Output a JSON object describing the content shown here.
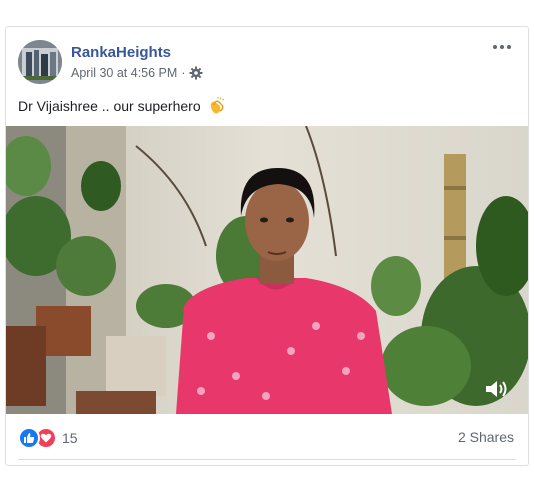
{
  "post": {
    "page_name": "RankaHeights",
    "timestamp": "April 30 at 4:56 PM",
    "separator": "·",
    "audience_icon": "gear-icon",
    "text": "Dr Vijaishree .. our superhero",
    "emoji": "clapping-hands-icon"
  },
  "video": {
    "volume_icon": "speaker-icon"
  },
  "footer": {
    "reaction_icons": [
      "like-icon",
      "love-icon"
    ],
    "reaction_count": "15",
    "shares": "2 Shares"
  },
  "colors": {
    "link": "#385898",
    "meta": "#616770",
    "like": "#1877f2",
    "love": "#f33e58",
    "shirt": "#e8376a"
  }
}
